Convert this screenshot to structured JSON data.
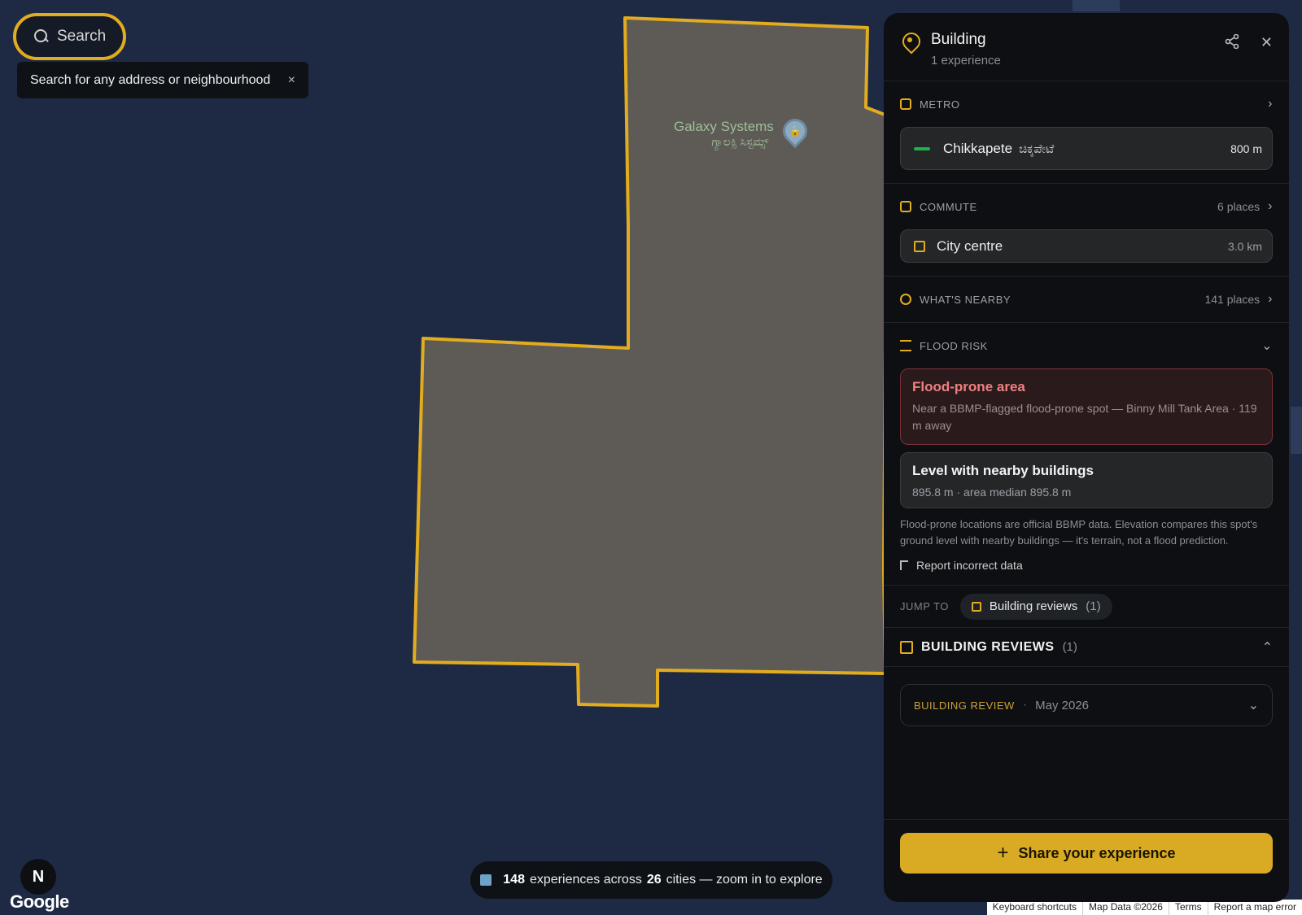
{
  "search": {
    "label": "Search"
  },
  "tooltip": {
    "text": "Search for any address or neighbourhood",
    "close": "×"
  },
  "map": {
    "poi_name": "Galaxy Systems",
    "poi_name_local": "ಗ್ಯಾಲಕ್ಸಿ ಸಿಸ್ಟಮ್ಸ್",
    "poi_icon": "lock-icon",
    "poi_glyph": "🔒"
  },
  "compass": {
    "label": "N"
  },
  "google": {
    "label": "Google"
  },
  "stats": {
    "count": "148",
    "text1": "experiences across",
    "cities": "26",
    "text2": "cities — zoom in to explore"
  },
  "attribution": [
    "Keyboard shortcuts",
    "Map Data ©2026",
    "Terms",
    "Report a map error"
  ],
  "panel": {
    "title": "Building",
    "subtitle": "1 experience",
    "share_icon": "share-icon",
    "close_glyph": "✕",
    "metro": {
      "label": "METRO",
      "station": "Chikkapete",
      "station_local": "ಚಿಕ್ಕಪೇಟೆ",
      "distance": "800 m",
      "line_color": "#1bb34a"
    },
    "commute": {
      "label": "COMMUTE",
      "meta": "6 places",
      "destination": "City centre",
      "distance": "3.0 km"
    },
    "nearby": {
      "label": "WHAT'S NEARBY",
      "meta": "141 places"
    },
    "flood": {
      "label": "FLOOD RISK",
      "alert_title": "Flood-prone area",
      "alert_text": "Near a BBMP-flagged flood-prone spot — Binny Mill Tank Area · 119 m away",
      "level_title": "Level with nearby buildings",
      "level_text": "895.8 m · area median 895.8 m",
      "note": "Flood-prone locations are official BBMP data. Elevation compares this spot's ground level with nearby buildings — it's terrain, not a flood prediction.",
      "report": "Report incorrect data"
    },
    "jump": {
      "label": "JUMP TO",
      "chip": "Building reviews",
      "chip_count": "(1)"
    },
    "reviews": {
      "title": "BUILDING REVIEWS",
      "count": "(1)",
      "item_kind": "BUILDING REVIEW",
      "item_date": "May 2026"
    },
    "cta": {
      "plus": "+",
      "label": "Share your experience"
    }
  },
  "colors": {
    "accent": "#e2ac1f",
    "map_bg": "#1e2a44",
    "building": "#5e5a56",
    "flood_alert": "#f08080"
  }
}
